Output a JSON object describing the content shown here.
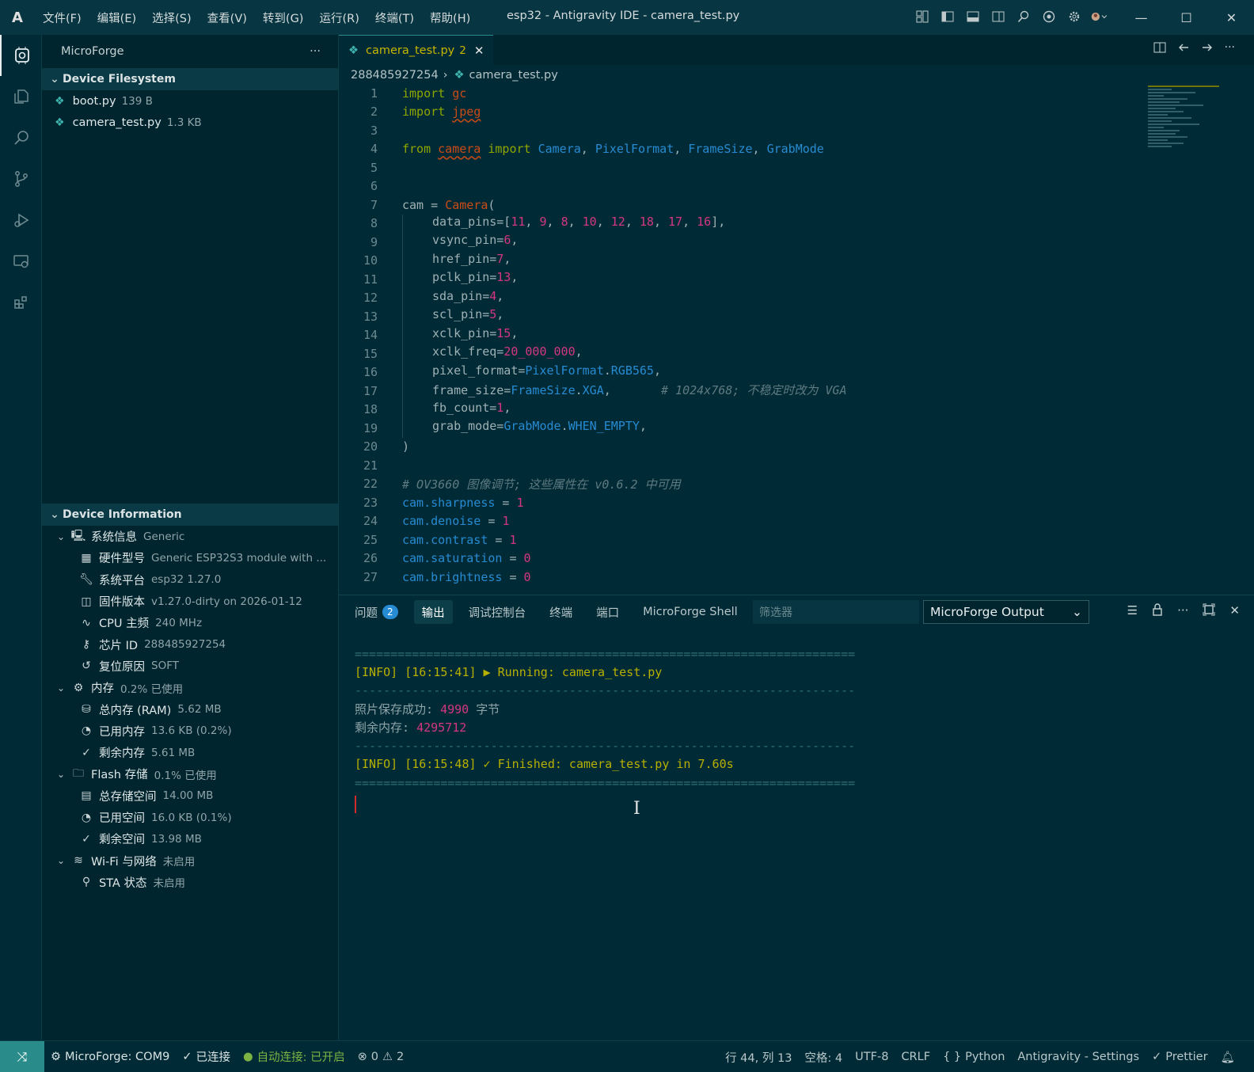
{
  "titlebar": {
    "logo": "A",
    "menus": [
      "文件(F)",
      "编辑(E)",
      "选择(S)",
      "查看(V)",
      "转到(G)",
      "运行(R)",
      "终端(T)",
      "帮助(H)"
    ],
    "window_title": "esp32 - Antigravity IDE - camera_test.py"
  },
  "sidebar": {
    "title": "MicroForge",
    "more": "···",
    "filesystem": {
      "heading": "Device Filesystem",
      "files": [
        {
          "name": "boot.py",
          "size": "139 B"
        },
        {
          "name": "camera_test.py",
          "size": "1.3 KB"
        }
      ]
    },
    "device_info": {
      "heading": "Device Information",
      "rows": [
        {
          "label": "系统信息",
          "value": "Generic",
          "level": 1,
          "icon": "computer-icon"
        },
        {
          "label": "硬件型号",
          "value": "Generic ESP32S3 module with ...",
          "level": 2,
          "icon": "chip-board-icon"
        },
        {
          "label": "系统平台",
          "value": "esp32 1.27.0",
          "level": 2,
          "icon": "wrench-icon"
        },
        {
          "label": "固件版本",
          "value": "v1.27.0-dirty on 2026-01-12",
          "level": 2,
          "icon": "firmware-icon"
        },
        {
          "label": "CPU 主频",
          "value": "240 MHz",
          "level": 2,
          "icon": "pulse-icon"
        },
        {
          "label": "芯片 ID",
          "value": "288485927254",
          "level": 2,
          "icon": "key-icon"
        },
        {
          "label": "复位原因",
          "value": "SOFT",
          "level": 2,
          "icon": "history-icon"
        },
        {
          "label": "内存",
          "value": "0.2% 已使用",
          "level": 1,
          "icon": "memory-chip-icon"
        },
        {
          "label": "总内存 (RAM)",
          "value": "5.62 MB",
          "level": 2,
          "icon": "database-icon"
        },
        {
          "label": "已用内存",
          "value": "13.6 KB (0.2%)",
          "level": 2,
          "icon": "pie-chart-icon"
        },
        {
          "label": "剩余内存",
          "value": "5.61 MB",
          "level": 2,
          "icon": "check-icon"
        },
        {
          "label": "Flash 存储",
          "value": "0.1% 已使用",
          "level": 1,
          "icon": "folder-icon"
        },
        {
          "label": "总存储空间",
          "value": "14.00 MB",
          "level": 2,
          "icon": "archive-icon"
        },
        {
          "label": "已用空间",
          "value": "16.0 KB (0.1%)",
          "level": 2,
          "icon": "pie-chart-icon"
        },
        {
          "label": "剩余空间",
          "value": "13.98 MB",
          "level": 2,
          "icon": "check-icon"
        },
        {
          "label": "Wi-Fi 与网络",
          "value": "未启用",
          "level": 1,
          "icon": "wifi-icon"
        },
        {
          "label": "STA 状态",
          "value": "未启用",
          "level": 2,
          "icon": "plug-icon"
        }
      ]
    }
  },
  "editor": {
    "tab": {
      "name": "camera_test.py",
      "problems": "2",
      "close": "✕"
    },
    "breadcrumb": {
      "folder": "288485927254",
      "file": "camera_test.py"
    },
    "lines": [
      "1",
      "2",
      "3",
      "4",
      "5",
      "6",
      "7",
      "8",
      "9",
      "10",
      "11",
      "12",
      "13",
      "14",
      "15",
      "16",
      "17",
      "18",
      "19",
      "20",
      "21",
      "22",
      "23",
      "24",
      "25",
      "26",
      "27"
    ]
  },
  "panel": {
    "tabs": [
      {
        "label": "问题",
        "badge": "2"
      },
      {
        "label": "输出"
      },
      {
        "label": "调试控制台"
      },
      {
        "label": "终端"
      },
      {
        "label": "端口"
      },
      {
        "label": "MicroForge Shell"
      }
    ],
    "filter_placeholder": "筛选器",
    "output_channel": "MicroForge Output",
    "output": {
      "sep_double": "======================================================================",
      "sep_single": "----------------------------------------------------------------------",
      "running": "[INFO] [16:15:41] ▶ Running: camera_test.py",
      "saved_label": "照片保存成功: ",
      "saved_value": "4990",
      "saved_unit": " 字节",
      "mem_label": "剩余内存: ",
      "mem_value": "4295712",
      "finished": "[INFO] [16:15:48] ✓ Finished: camera_test.py in 7.60s"
    }
  },
  "statusbar": {
    "remote": "⤨",
    "port": "MicroForge: COM9",
    "connected": "已连接",
    "autoconnect": "自动连接: 已开启",
    "errors": "0",
    "warnings": "2",
    "position": "行 44, 列 13",
    "spaces": "空格: 4",
    "encoding": "UTF-8",
    "eol": "CRLF",
    "language": "Python",
    "settings": "Antigravity - Settings",
    "prettier": "Prettier"
  }
}
